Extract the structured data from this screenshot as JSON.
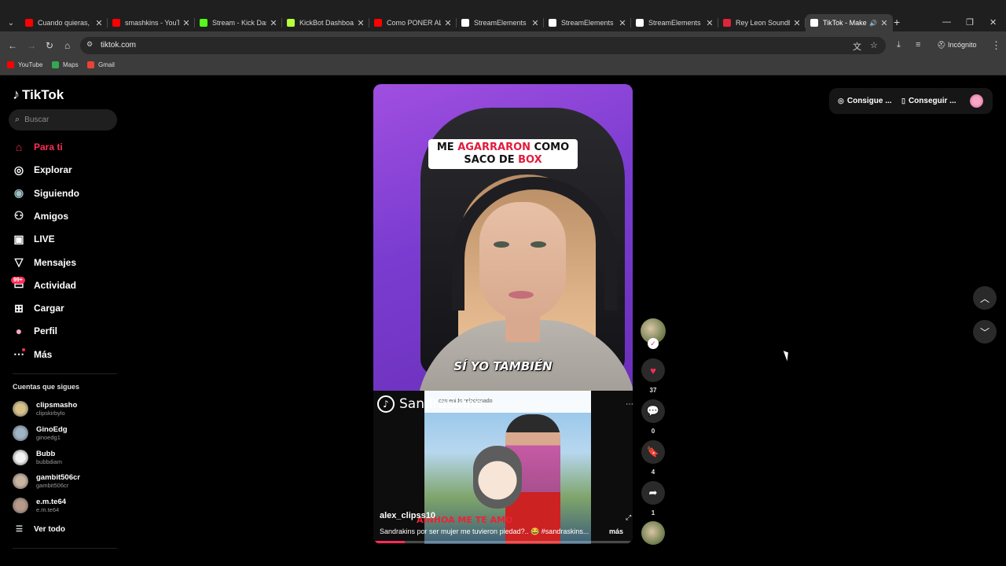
{
  "browser": {
    "tabs": [
      {
        "title": "Cuando quieras, o",
        "favicon": "youtube-icon",
        "color": "#ff0000"
      },
      {
        "title": "smashkins - YouT",
        "favicon": "youtube-icon",
        "color": "#ff0000"
      },
      {
        "title": "Stream - Kick Das",
        "favicon": "kick-icon",
        "color": "#53fc18"
      },
      {
        "title": "KickBot Dashboar",
        "favicon": "kickbot-icon",
        "color": "#b6ff3b"
      },
      {
        "title": "Como PONER ALE",
        "favicon": "youtube-icon",
        "color": "#ff0000"
      },
      {
        "title": "StreamElements -",
        "favicon": "streamelements-icon",
        "color": "#ffffff"
      },
      {
        "title": "StreamElements -",
        "favicon": "streamelements-icon",
        "color": "#ffffff"
      },
      {
        "title": "StreamElements -",
        "favicon": "streamelements-icon",
        "color": "#ffffff"
      },
      {
        "title": "Rey Leon Soundb",
        "favicon": "soundboard-icon",
        "color": "#e0243a"
      },
      {
        "title": "TikTok - Make",
        "favicon": "tiktok-icon",
        "color": "#ffffff",
        "active": true
      }
    ],
    "url": "tiktok.com",
    "incognito_label": "Incógnito",
    "bookmarks": [
      {
        "label": "YouTube",
        "icon": "youtube-icon",
        "color": "#ff0000"
      },
      {
        "label": "Maps",
        "icon": "maps-icon",
        "color": "#34a853"
      },
      {
        "label": "Gmail",
        "icon": "gmail-icon",
        "color": "#ea4335"
      }
    ]
  },
  "tiktok": {
    "logo": "TikTok",
    "search_placeholder": "Buscar",
    "nav": [
      {
        "label": "Para ti",
        "icon": "home-icon",
        "active": true
      },
      {
        "label": "Explorar",
        "icon": "compass-icon"
      },
      {
        "label": "Siguiendo",
        "icon": "following-icon"
      },
      {
        "label": "Amigos",
        "icon": "friends-icon"
      },
      {
        "label": "LIVE",
        "icon": "live-icon"
      },
      {
        "label": "Mensajes",
        "icon": "messages-icon"
      },
      {
        "label": "Actividad",
        "icon": "activity-icon",
        "badge": "99+"
      },
      {
        "label": "Cargar",
        "icon": "upload-icon"
      },
      {
        "label": "Perfil",
        "icon": "profile-icon"
      },
      {
        "label": "Más",
        "icon": "more-icon"
      }
    ],
    "following_title": "Cuentas que sigues",
    "following": [
      {
        "name": "clipsmasho",
        "handle": "clipskirbylo"
      },
      {
        "name": "GinoEdg",
        "handle": "ginoedg1"
      },
      {
        "name": "Bubb",
        "handle": "bubbdiam"
      },
      {
        "name": "gambit506cr",
        "handle": "gambit506cr"
      },
      {
        "name": "e.m.te64",
        "handle": "e.m.te64"
      }
    ],
    "see_all": "Ver todo",
    "top_right": {
      "coins": "Consigue ...",
      "app": "Conseguir ..."
    },
    "video": {
      "caption_line1_a": "ME ",
      "caption_line1_b": "AGARRARON",
      "caption_line1_c": " COMO",
      "caption_line2_a": "SACO DE ",
      "caption_line2_b": "BOX",
      "subtitle": "SÍ YO TAMBIÉN",
      "watermark": "SandraSkins",
      "inner_bar_text": "contenido relacionado",
      "inner_overlay": "AINHOA ME TE AMO",
      "author": "alex_clipss10",
      "description": "Sandrakins por ser mujer me tuvieron piedad?.. 😂 #sandraskins...",
      "more": "más",
      "progress": 0.12
    },
    "actions": {
      "likes": "37",
      "comments": "0",
      "saves": "4",
      "shares": "1"
    },
    "accent_color": "#fe2c55"
  }
}
